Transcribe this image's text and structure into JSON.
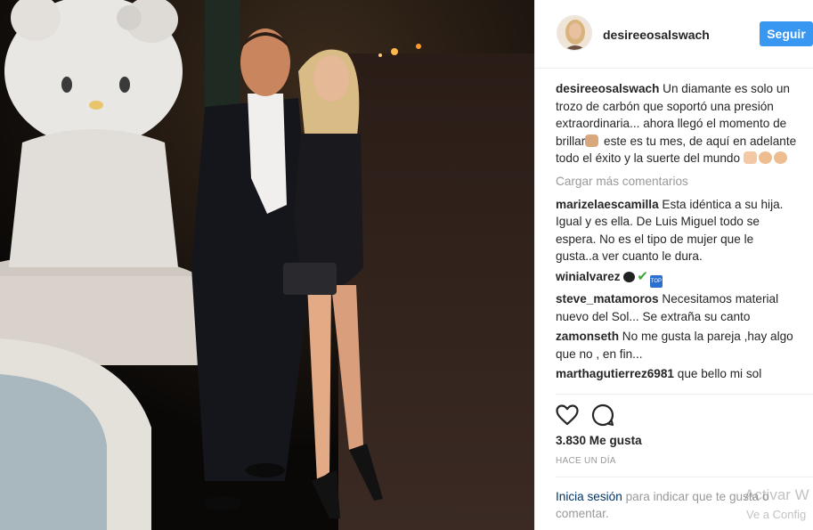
{
  "post": {
    "username": "desireeosalswach",
    "follow_label": "Seguir",
    "likes": "3.830 Me gusta",
    "time_ago": "HACE UN DÍA"
  },
  "caption": {
    "username": "desireeosalswach",
    "text_part1": "Un diamante es solo un trozo de carbón que soportó una presión extraordinaria... ahora llegó el momento de brillar",
    "text_part2": " este es tu mes, de aquí en adelante todo el éxito y la suerte del mundo "
  },
  "load_more": "Cargar más comentarios",
  "comments": [
    {
      "user": "marizelaescamilla",
      "text": "Esta idéntica a su hija. Igual y es ella. De Luis Miguel todo se espera. No es el tipo de mujer que le gusta..a ver cuanto le dura."
    },
    {
      "user": "winialvarez",
      "text": ""
    },
    {
      "user": "steve_matamoros",
      "text": "Necesitamos material nuevo del Sol... Se extraña su canto"
    },
    {
      "user": "zamonseth",
      "text": "No me gusta la pareja ,hay algo que no , en fin..."
    },
    {
      "user": "marthagutierrez6981",
      "text": "que bello mi sol"
    }
  ],
  "emoji_glyphs": {
    "top_label": "TOP",
    "check": "✔"
  },
  "login": {
    "link": "Inicia sesión",
    "text": " para indicar que te gusta o comentar."
  },
  "watermark": {
    "title": "Activar W",
    "subtitle": "Ve a Config"
  },
  "icons": [
    "heart-icon",
    "comment-icon"
  ],
  "colors": {
    "accent": "#3897f0",
    "link": "#003569",
    "muted": "#999999"
  }
}
